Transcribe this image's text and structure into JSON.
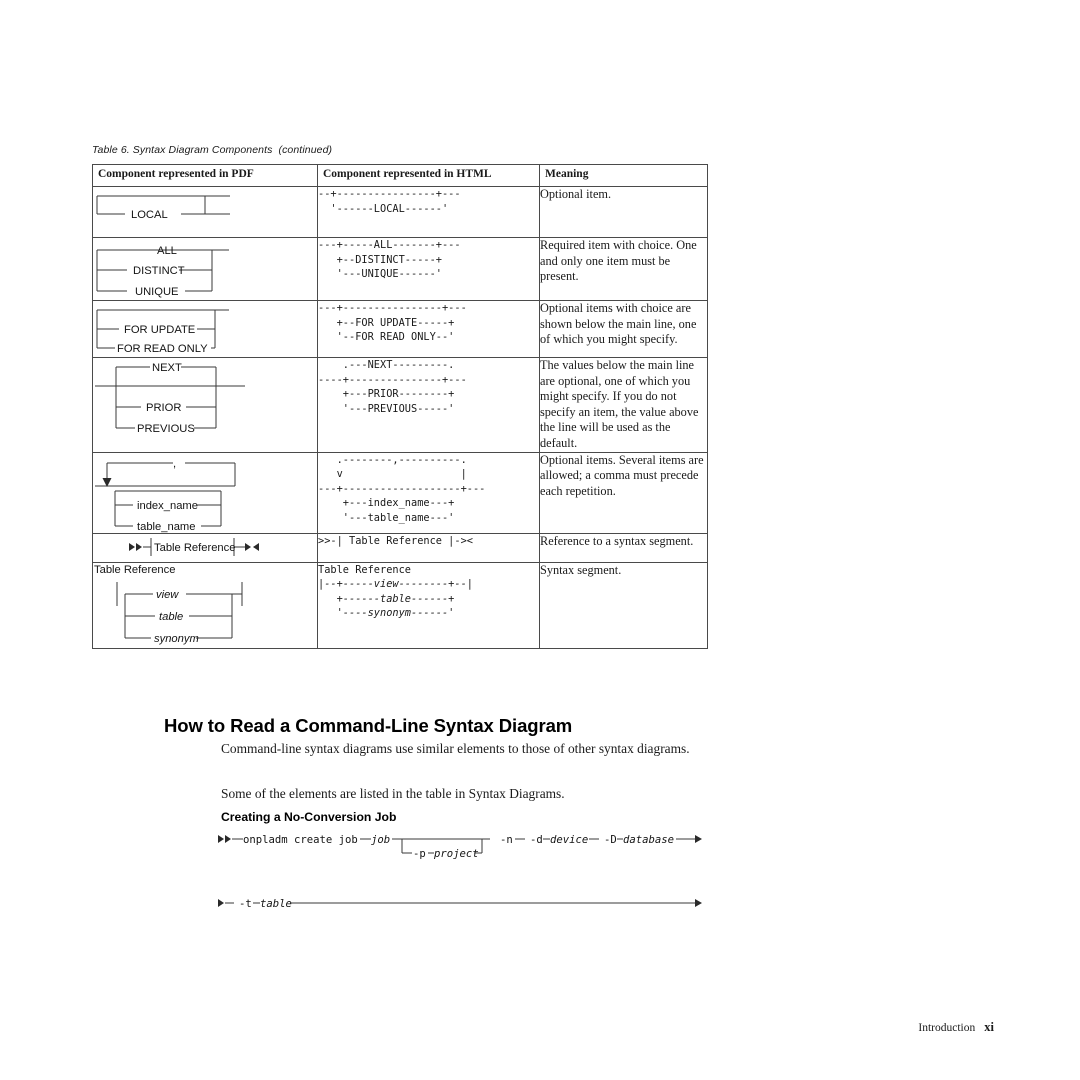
{
  "table": {
    "caption_label": "Table 6.",
    "caption_title": "Syntax Diagram Components",
    "caption_note": "(continued)",
    "caption_full": "Table 6. Syntax Diagram Components  (continued)",
    "headers": [
      "Component represented in PDF",
      "Component represented in HTML",
      "Meaning"
    ],
    "rows": [
      {
        "id": "optional-item",
        "pdf_labels": [
          "LOCAL"
        ],
        "html_art": "--+----------------+---\n  '------LOCAL------'",
        "meaning": "Optional item."
      },
      {
        "id": "required-item-with-choice",
        "pdf_labels": [
          "ALL",
          "DISTINCT",
          "UNIQUE"
        ],
        "html_art": "---+-----ALL-------+---\n   +--DISTINCT-----+\n   '---UNIQUE------'",
        "meaning": "Required item with choice. One and only one item must be present."
      },
      {
        "id": "optional-items-with-choice",
        "pdf_labels": [
          "FOR UPDATE",
          "FOR READ ONLY"
        ],
        "html_art": "---+----------------+---\n   +--FOR UPDATE-----+\n   '--FOR READ ONLY--'",
        "meaning": "Optional items with choice are shown below the main line, one of which you might specify."
      },
      {
        "id": "default-above-line",
        "pdf_labels": [
          "NEXT",
          "PRIOR",
          "PREVIOUS"
        ],
        "html_art": "    .---NEXT---------.\n----+---------------+---\n    +---PRIOR--------+\n    '---PREVIOUS-----'",
        "meaning": "The values below the main line are optional, one of which you might specify. If you do not specify an item, the value above the line will be used as the default."
      },
      {
        "id": "repeating-items",
        "pdf_labels": [
          "index_name",
          "table_name"
        ],
        "pdf_separator": ",",
        "html_art": "   .--------,----------.\n   v                   |\n---+-------------------+---\n    +---index_name---+\n    '---table_name---'",
        "meaning": "Optional items. Several items are allowed; a comma must precede each repetition."
      },
      {
        "id": "segment-reference",
        "pdf_labels": [
          "Table Reference"
        ],
        "html_art": ">>-| Table Reference |-><",
        "meaning": "Reference to a syntax segment."
      },
      {
        "id": "syntax-segment",
        "pdf_title": "Table Reference",
        "pdf_labels": [
          "view",
          "table",
          "synonym"
        ],
        "html_title": "Table Reference",
        "html_art": "|--+-----view--------+--|\n   +------table------+\n   '----synonym------'",
        "meaning": "Syntax segment."
      }
    ]
  },
  "section": {
    "heading": "How to Read a Command-Line Syntax Diagram",
    "paragraph_1": "Command-line syntax diagrams use similar elements to those of other syntax diagrams.",
    "paragraph_2": "Some of the elements are listed in the table in Syntax Diagrams.",
    "subheading": "Creating a No-Conversion Job"
  },
  "command_diagram": {
    "line1_tokens": [
      "onpladm create job",
      "job"
    ],
    "command_text": "onpladm create job",
    "job_var": "job",
    "option_p_flag": "-p",
    "option_p_var": "project",
    "flag_n": "-n",
    "flag_d": "-d",
    "var_device": "device",
    "flag_D": "-D",
    "var_database": "database",
    "flag_t": "-t",
    "var_table": "table"
  },
  "footer": {
    "label": "Introduction",
    "page_number": "xi"
  }
}
